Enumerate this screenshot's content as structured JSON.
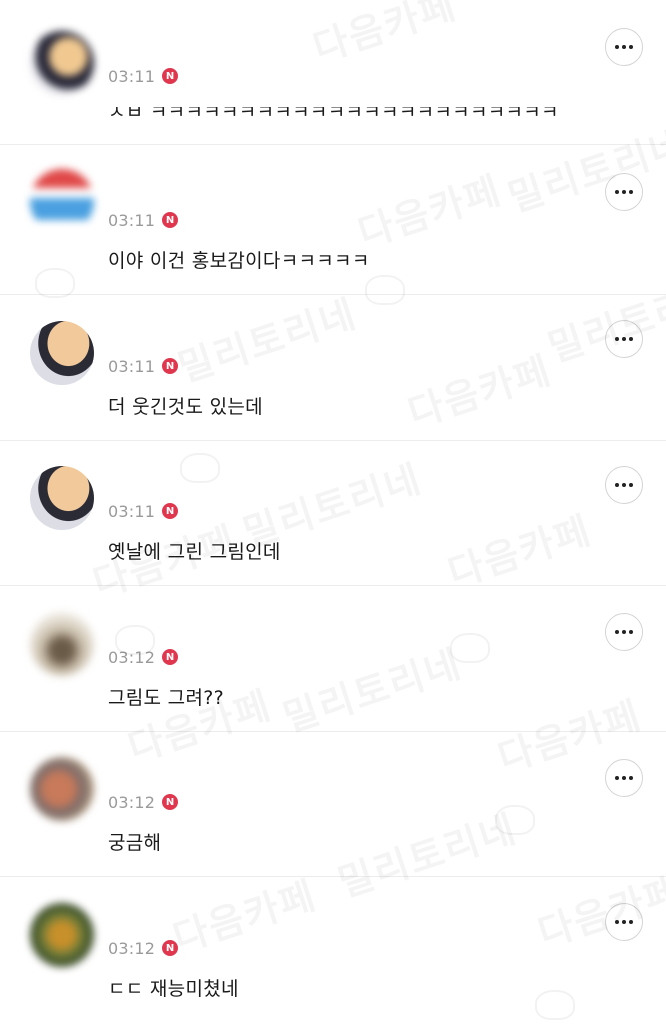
{
  "watermark": {
    "cafe": "다음카페",
    "community": "밀리토리네"
  },
  "comments": [
    {
      "time": "03:11",
      "badge": "N",
      "text": "ㅅㅂ ㅋㅋㅋㅋㅋㅋㅋㅋㅋㅋㅋㅋㅋㅋㅋㅋㅋㅋㅋㅋㅋㅋㅋ",
      "avatar_color": "#e3b985"
    },
    {
      "time": "03:11",
      "badge": "N",
      "text": "이야 이건 홍보감이다ㅋㅋㅋㅋㅋ",
      "avatar_color": "#5aa3dc"
    },
    {
      "time": "03:11",
      "badge": "N",
      "text": "더 웃긴것도 있는데",
      "avatar_color": "#f2c99a"
    },
    {
      "time": "03:11",
      "badge": "N",
      "text": "옛날에 그린 그림인데",
      "avatar_color": "#f2c99a"
    },
    {
      "time": "03:12",
      "badge": "N",
      "text": "그림도 그려??",
      "avatar_color": "#a89a86"
    },
    {
      "time": "03:12",
      "badge": "N",
      "text": "궁금해",
      "avatar_color": "#b07050"
    },
    {
      "time": "03:12",
      "badge": "N",
      "text": "ㄷㄷ 재능미쳤네",
      "avatar_color": "#6a7a3a"
    }
  ],
  "more_icon": "more-horizontal-icon",
  "colors": {
    "badge": "#e0364e",
    "time": "#9a9a9a",
    "divider": "#ececec"
  }
}
